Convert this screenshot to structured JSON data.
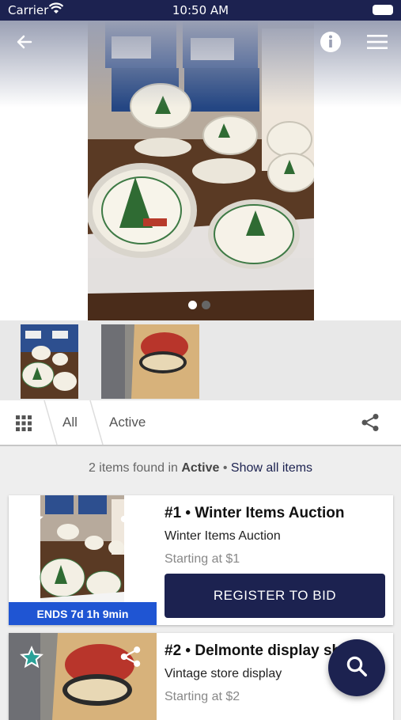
{
  "status": {
    "carrier": "Carrier",
    "time": "10:50 AM"
  },
  "gallery": {
    "slide_count": 2,
    "active_slide": 1
  },
  "filters": {
    "tab_all": "All",
    "tab_active": "Active"
  },
  "summary": {
    "count_text": "2 items found in",
    "filter_name": "Active",
    "separator": "•",
    "show_all": "Show all items"
  },
  "items": [
    {
      "title": "#1 • Winter Items Auction",
      "subtitle": "Winter Items Auction",
      "starting": "Starting at $1",
      "cta": "REGISTER TO BID",
      "ends": "ENDS 7d 1h 9min"
    },
    {
      "title": "#2 • Delmonte display sh",
      "subtitle": "Vintage store display",
      "starting": "Starting at $2"
    }
  ],
  "colors": {
    "navy": "#1c2250",
    "ends_blue": "#1f55d3"
  }
}
